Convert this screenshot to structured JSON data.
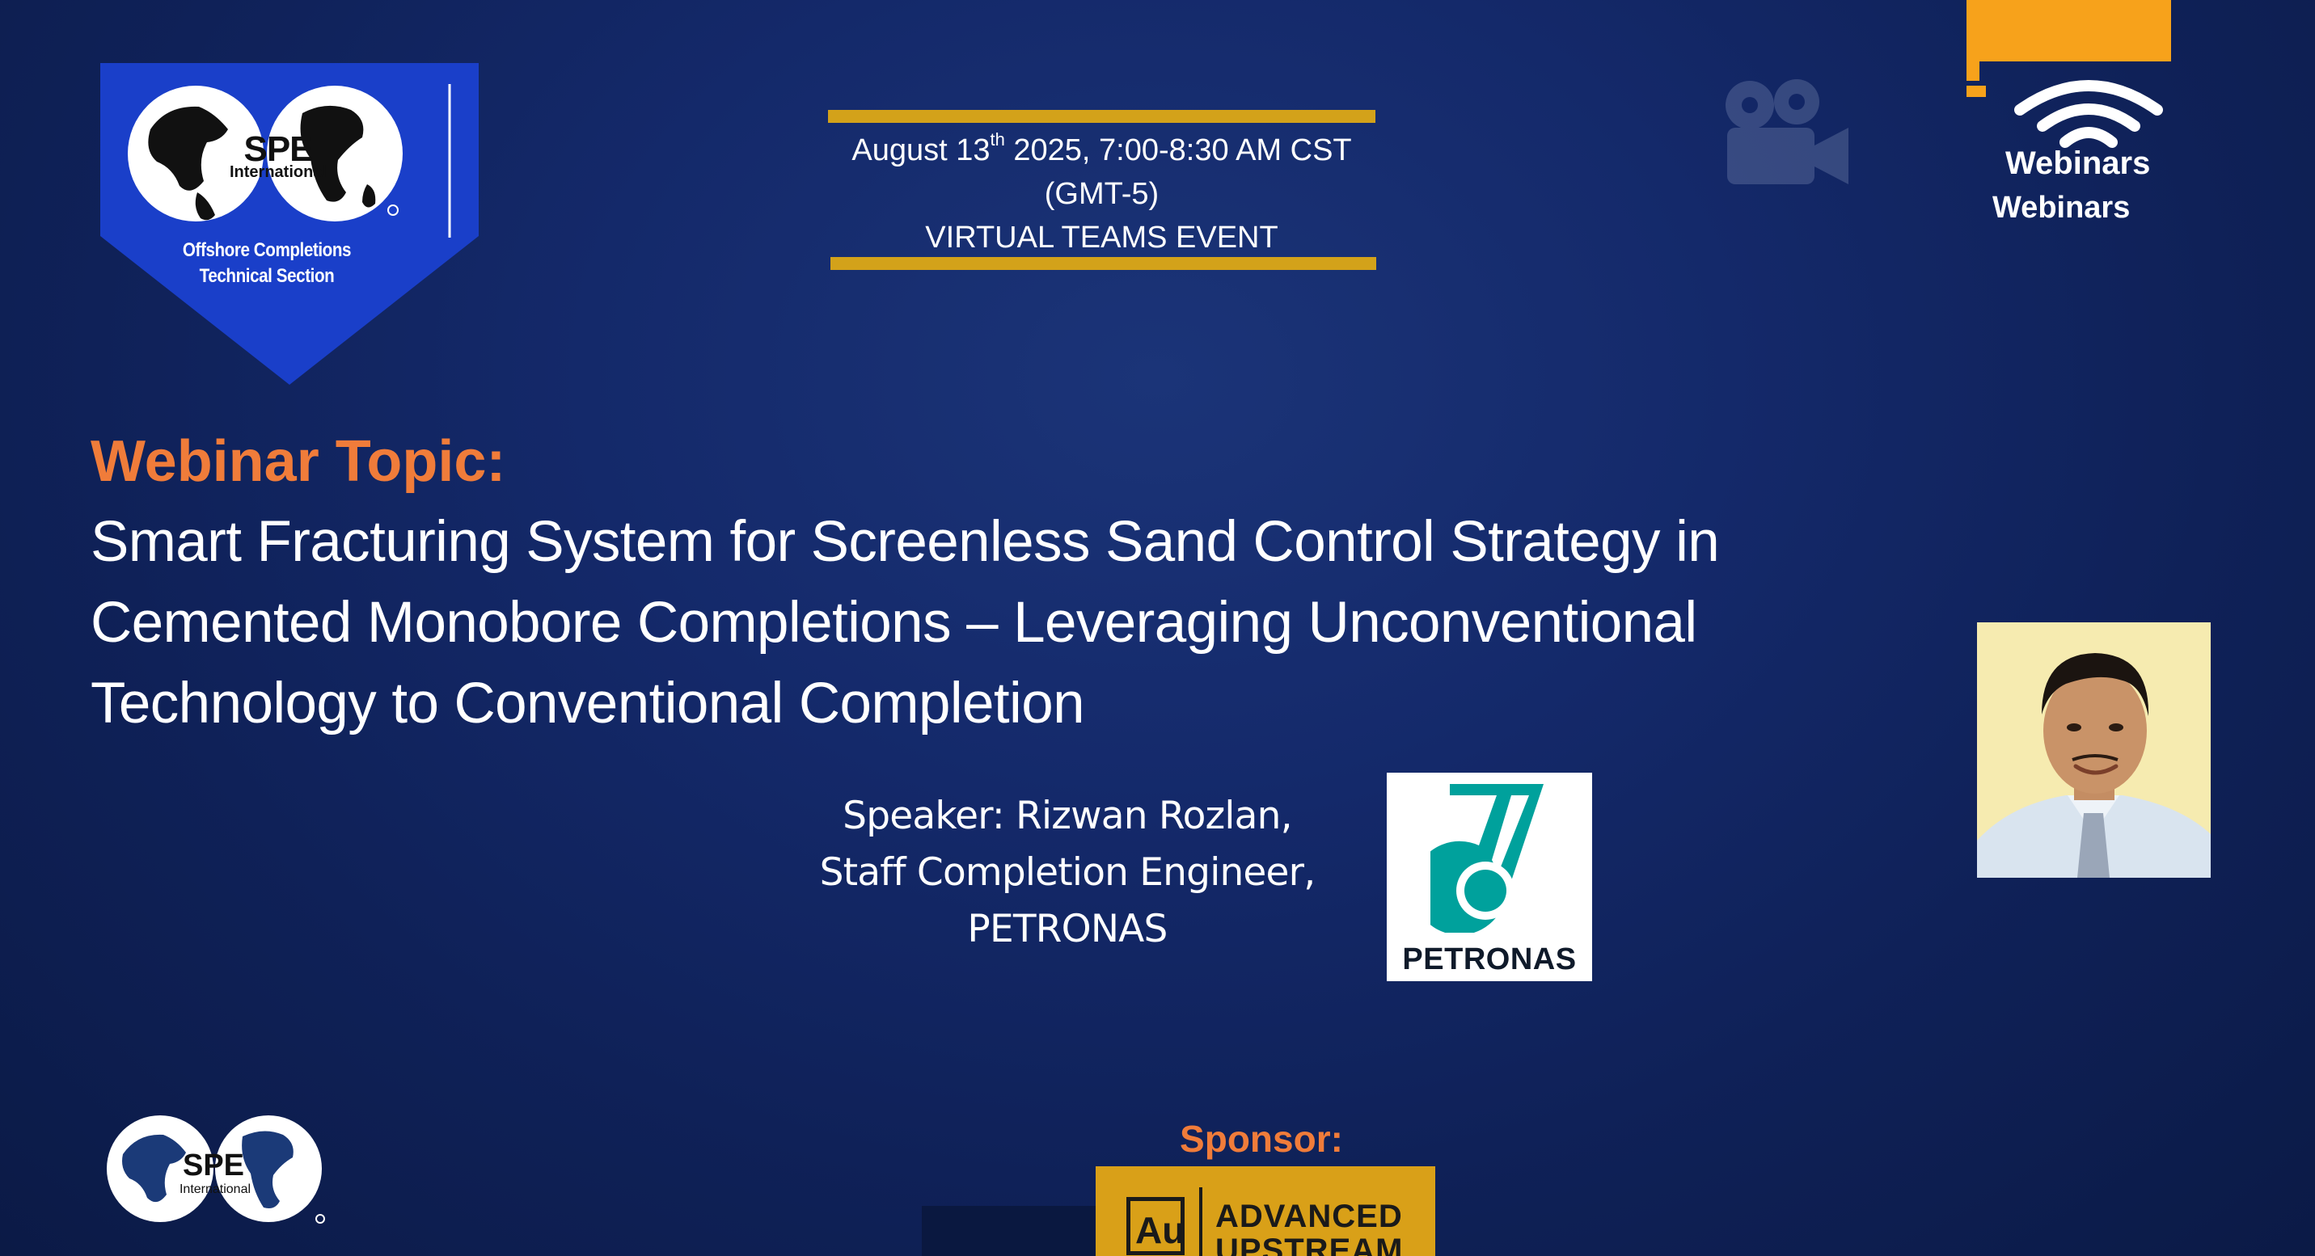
{
  "badge": {
    "logo_text": "SPE",
    "logo_subtext": "International",
    "caption_line1": "Offshore Completions",
    "caption_line2": "Technical Section"
  },
  "event": {
    "date_prefix": "August 13",
    "date_suffix": "th",
    "date_rest": " 2025, 7:00-8:30 AM CST",
    "timezone": "(GMT-5)",
    "format": "VIRTUAL TEAMS EVENT"
  },
  "webinars_logo": {
    "line1": "Webinars",
    "line2": "Webinars"
  },
  "topic": {
    "heading": "Webinar Topic:",
    "lines": [
      "Smart Fracturing System for Screenless Sand Control Strategy in",
      "Cemented Monobore Completions – Leveraging Unconventional",
      "Technology to Conventional Completion"
    ]
  },
  "speaker": {
    "lines": [
      "Speaker: Rizwan Rozlan,",
      "Staff Completion Engineer,",
      "PETRONAS"
    ]
  },
  "petronas_logo": {
    "text": "PETRONAS"
  },
  "spe_small_logo": {
    "text": "SPE",
    "subtext": "International"
  },
  "sponsor": {
    "label": "Sponsor:",
    "mark": "Au",
    "name_line1": "ADVANCED",
    "name_line2": "UPSTREAM"
  },
  "icons": {
    "camera": "video-camera-icon",
    "wifi": "wifi-icon"
  },
  "colors": {
    "background": "#14296a",
    "accent_orange": "#f07c3a",
    "gold": "#d3a21a",
    "spe_blue": "#1a3fc9",
    "petronas_teal": "#00a19c",
    "webinars_orange": "#f7a21b"
  }
}
